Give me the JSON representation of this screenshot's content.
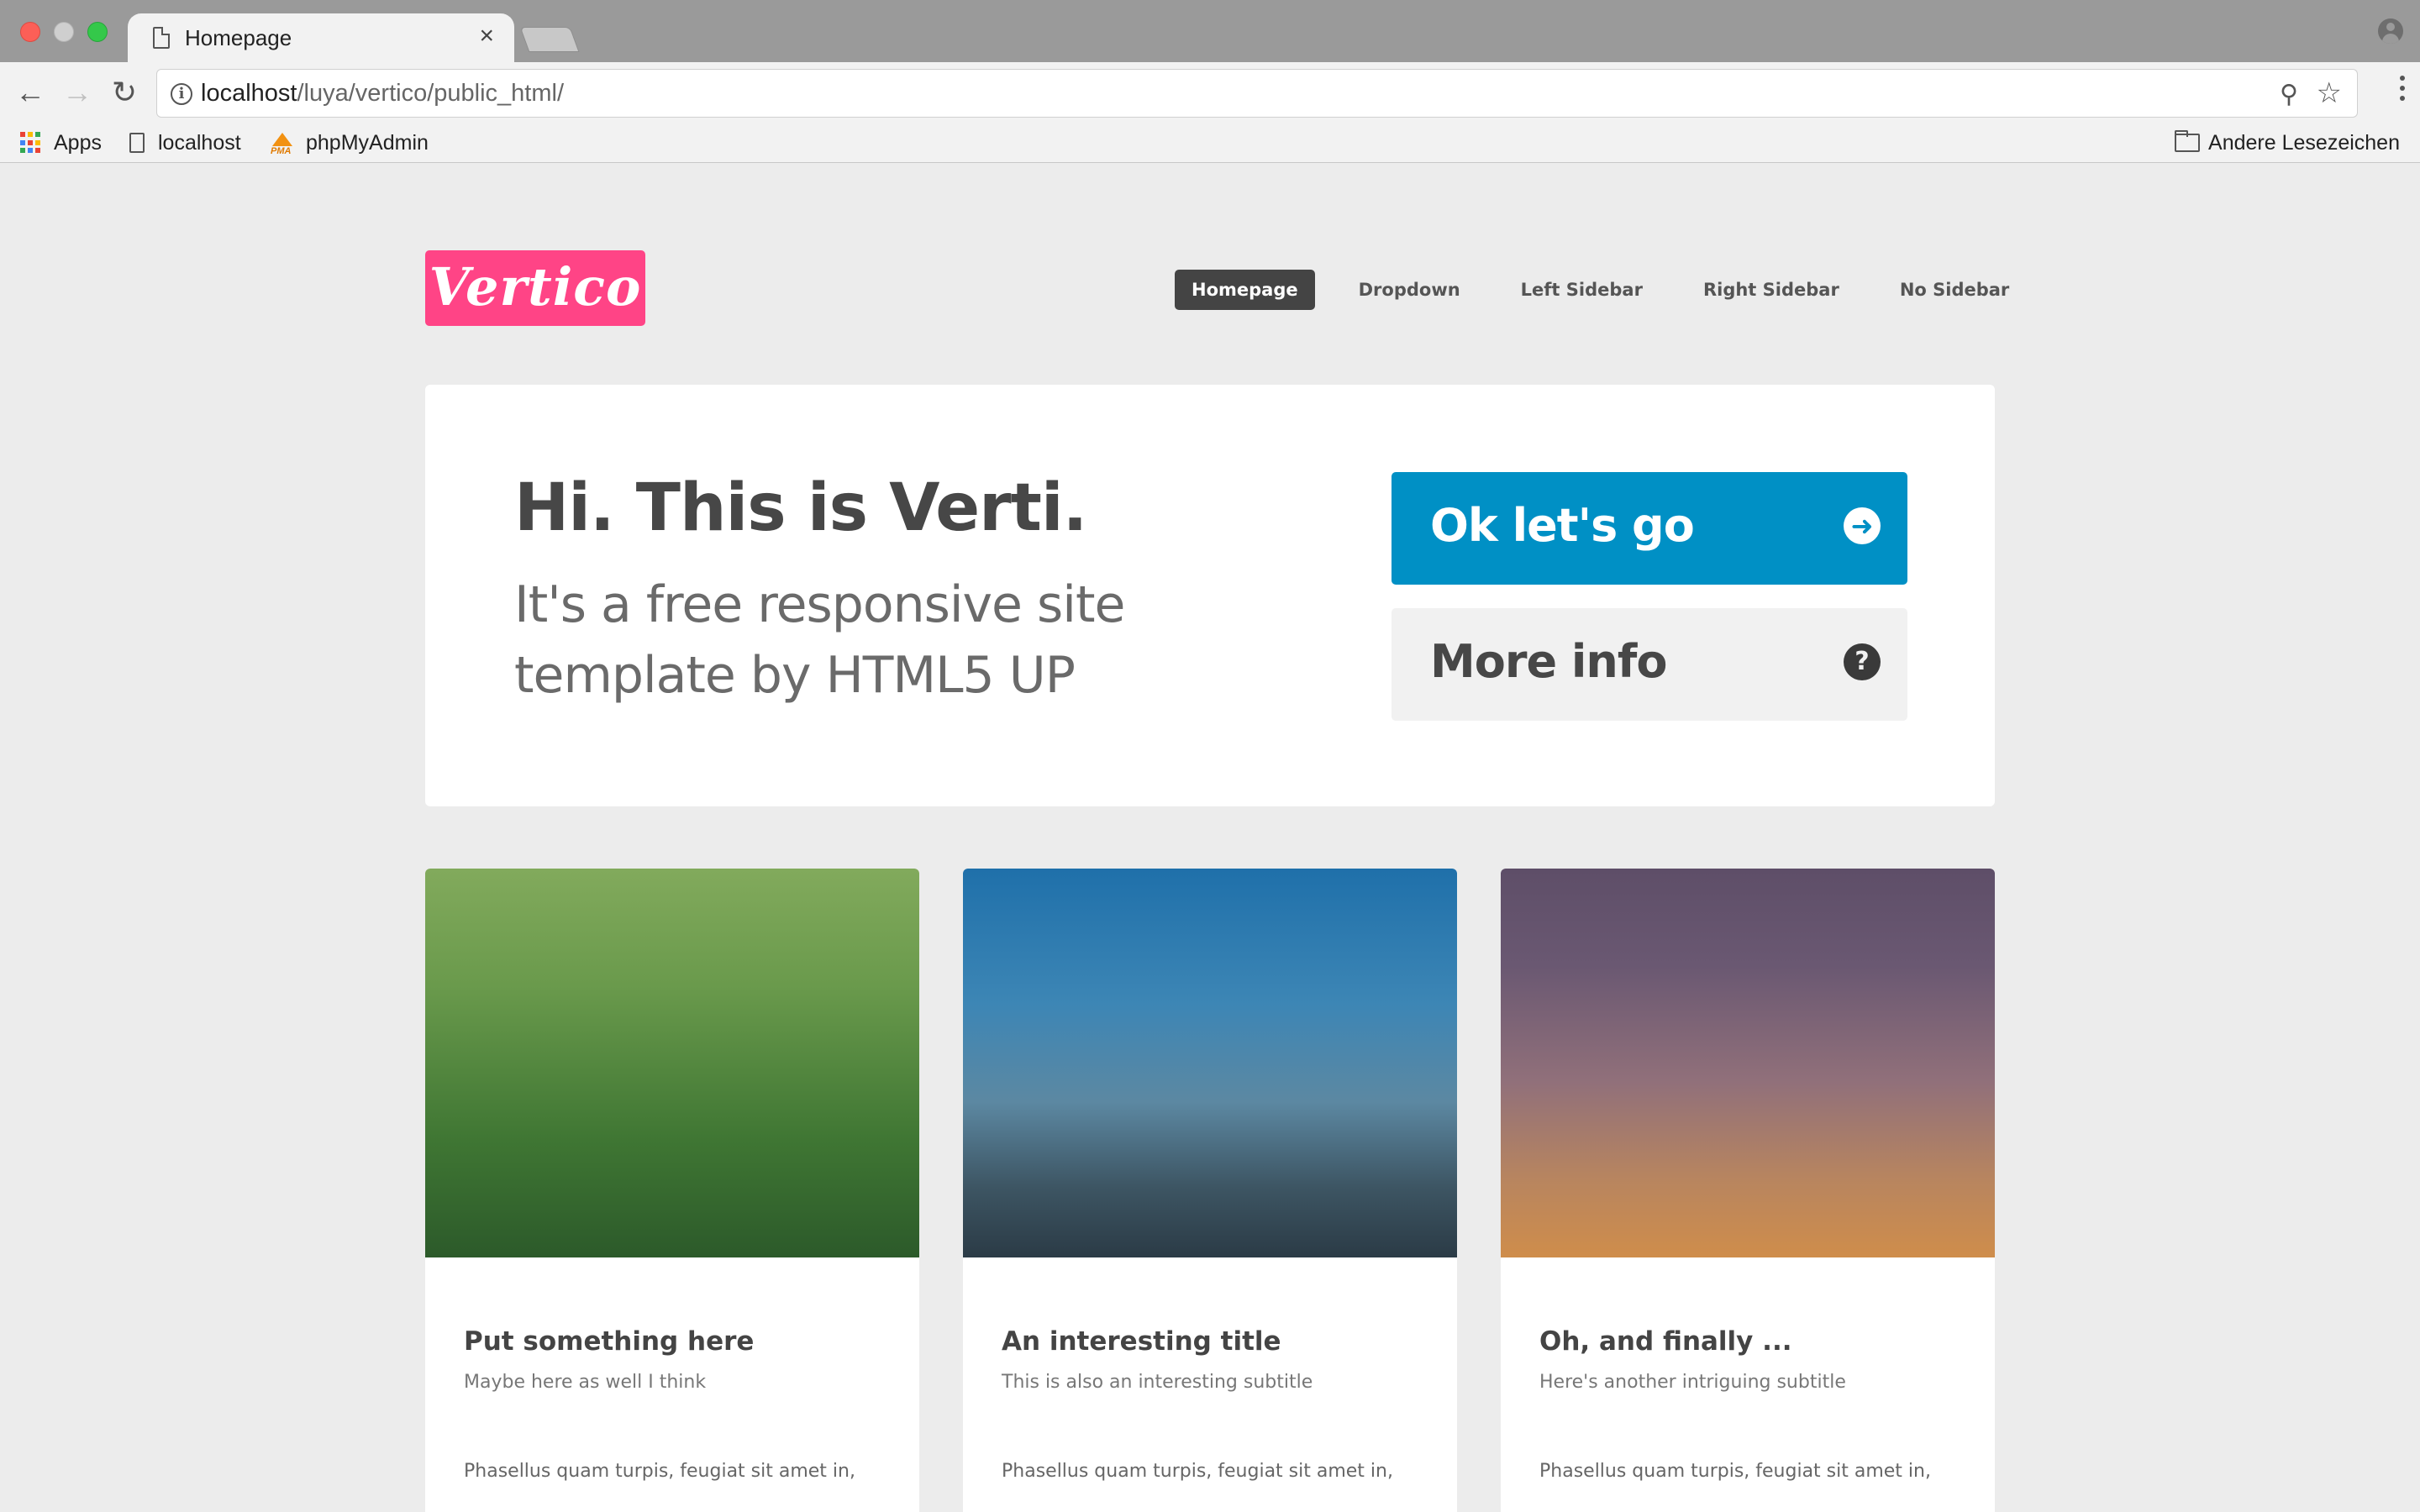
{
  "browser": {
    "tab_title": "Homepage",
    "tab_close": "×",
    "url_host": "localhost",
    "url_path": "/luya/vertico/public_html/",
    "bookmarks": [
      {
        "label": "Apps"
      },
      {
        "label": "localhost"
      },
      {
        "label": "phpMyAdmin",
        "icon_text": "PMA"
      }
    ],
    "other_bookmarks": "Andere Lesezeichen",
    "apps_colors": [
      "#ea4335",
      "#fbbc05",
      "#34a853",
      "#4285f4",
      "#ea4335",
      "#fbbc05",
      "#34a853",
      "#4285f4",
      "#ea4335"
    ]
  },
  "site": {
    "logo": "Vertico",
    "brand_color": "#ff4486",
    "accent_color": "#0090c5",
    "nav": [
      {
        "label": "Homepage",
        "active": true
      },
      {
        "label": "Dropdown"
      },
      {
        "label": "Left Sidebar"
      },
      {
        "label": "Right Sidebar"
      },
      {
        "label": "No Sidebar"
      }
    ]
  },
  "banner": {
    "title": "Hi. This is Verti.",
    "subtitle": "It's a free responsive site template by HTML5 UP",
    "primary_button": {
      "label": "Ok let's go",
      "icon": "arrow-right-icon"
    },
    "secondary_button": {
      "label": "More info",
      "icon": "question-icon"
    }
  },
  "cards": [
    {
      "title": "Put something here",
      "subtitle": "Maybe here as well I think",
      "text": "Phasellus quam turpis, feugiat sit amet in,"
    },
    {
      "title": "An interesting title",
      "subtitle": "This is also an interesting subtitle",
      "text": "Phasellus quam turpis, feugiat sit amet in,"
    },
    {
      "title": "Oh, and finally ...",
      "subtitle": "Here's another intriguing subtitle",
      "text": "Phasellus quam turpis, feugiat sit amet in,"
    }
  ]
}
